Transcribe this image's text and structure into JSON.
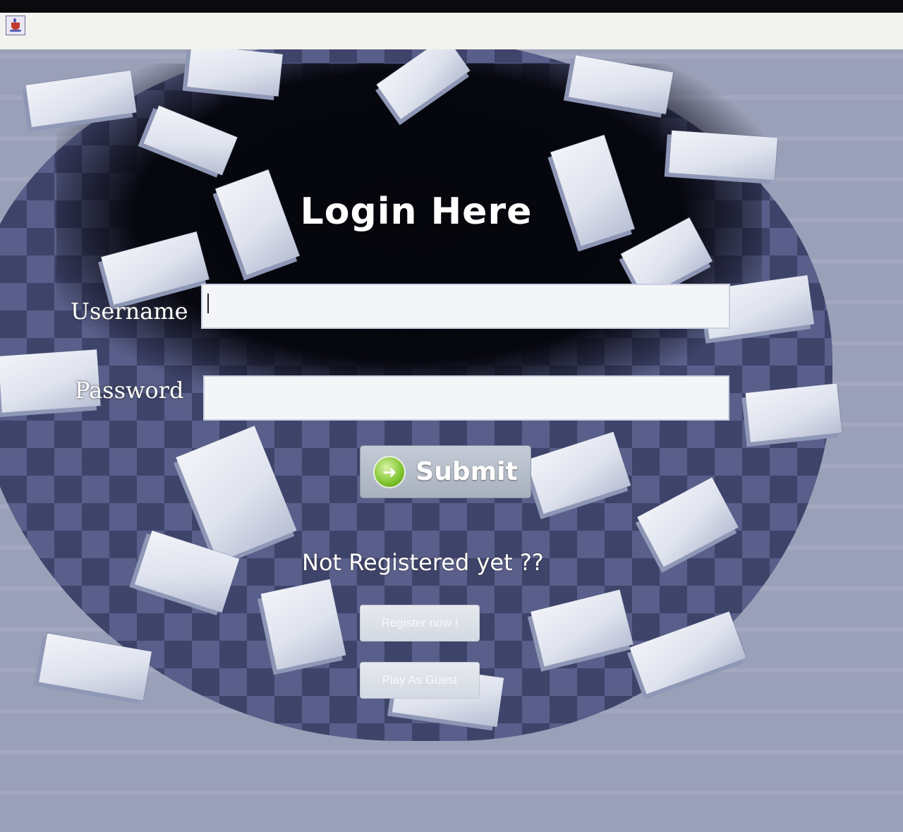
{
  "window": {
    "icon": "java-cup-icon"
  },
  "login": {
    "title": "Login Here",
    "username_label": "Username",
    "username_value": "",
    "password_label": "Password",
    "password_value": "",
    "submit_label": "Submit",
    "submit_icon": "arrow-right-circle-icon",
    "not_registered_text": "Not Registered yet ??",
    "register_label": "Register now !",
    "guest_label": "Play As Guest"
  }
}
